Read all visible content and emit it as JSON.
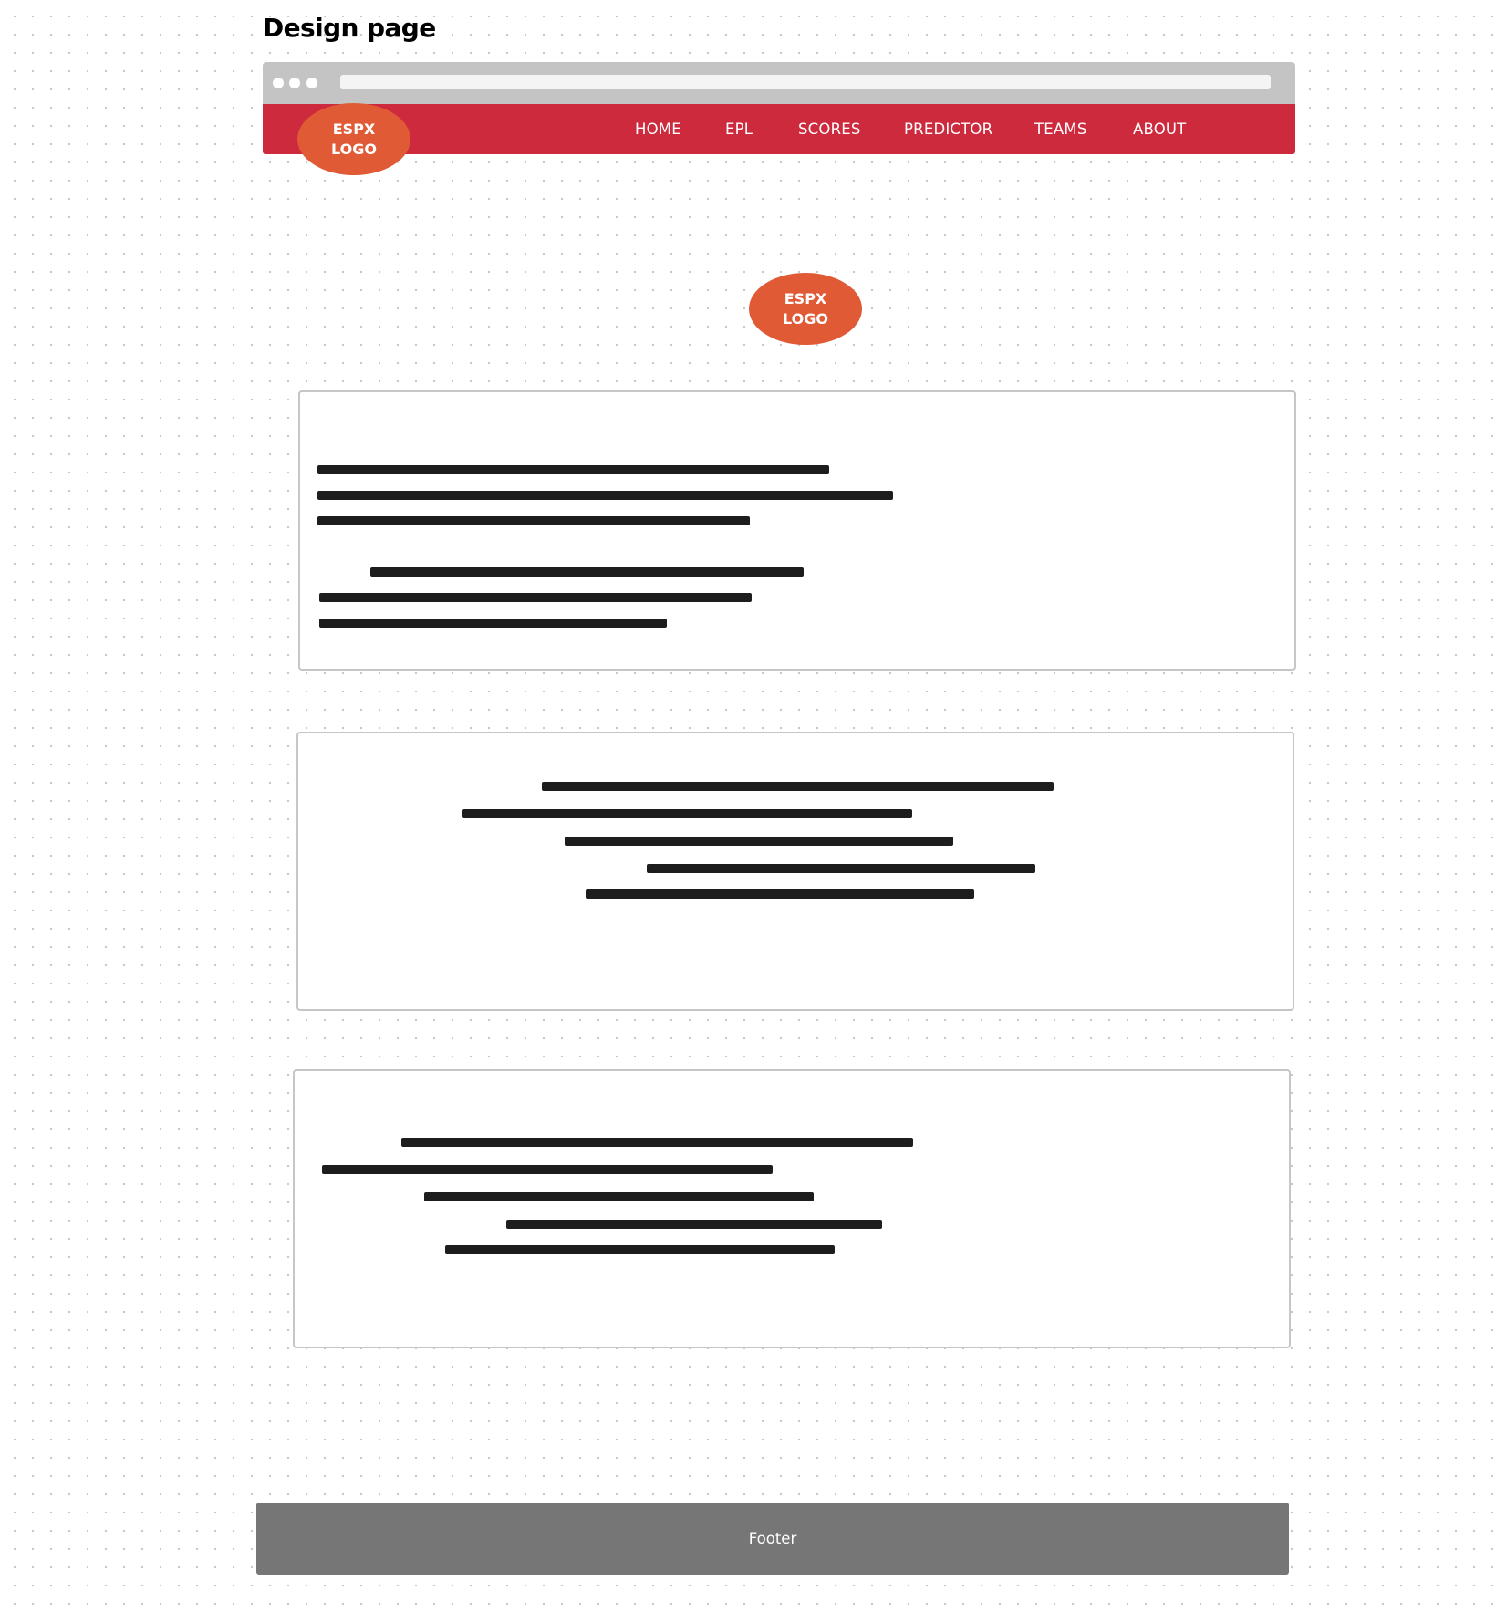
{
  "page": {
    "title": "Design page"
  },
  "browser": {
    "dot_count": 3
  },
  "header": {
    "logo": {
      "line1": "ESPX",
      "line2": "LOGO"
    },
    "nav": [
      {
        "label": "HOME"
      },
      {
        "label": "EPL"
      },
      {
        "label": "SCORES"
      },
      {
        "label": "PREDICTOR"
      },
      {
        "label": "TEAMS"
      },
      {
        "label": "ABOUT"
      }
    ]
  },
  "hero": {
    "logo": {
      "line1": "ESPX",
      "line2": "LOGO"
    }
  },
  "content_cards": [
    {
      "text_lines": 6,
      "alignment": "left"
    },
    {
      "text_lines": 5,
      "alignment": "center"
    },
    {
      "text_lines": 5,
      "alignment": "left"
    }
  ],
  "footer": {
    "label": "Footer"
  },
  "colors": {
    "nav_background": "#cd2a3e",
    "logo": "#e05a36",
    "browser_chrome": "#c4c4c4",
    "footer": "#767676",
    "text_placeholder": "#1d1d1d"
  }
}
